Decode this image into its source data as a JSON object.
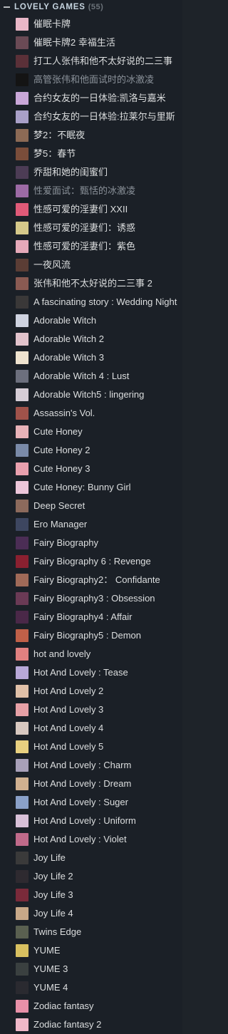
{
  "collection": {
    "name": "LOVELY GAMES",
    "count": "(55)"
  },
  "games": [
    {
      "title": "催眠卡牌",
      "installed": true,
      "icon_color": "#e9b7c7"
    },
    {
      "title": "催眠卡牌2 幸福生活",
      "installed": true,
      "icon_color": "#6a4a55"
    },
    {
      "title": "打工人张伟和他不太好说的二三事",
      "installed": true,
      "icon_color": "#5a3038"
    },
    {
      "title": "高管张伟和他面试时的冰激凌",
      "installed": false,
      "icon_color": "#141414"
    },
    {
      "title": "合约女友的一日体验:凯洛与嘉米",
      "installed": true,
      "icon_color": "#c9a7d8"
    },
    {
      "title": "合约女友的一日体验:拉莱尔与里斯",
      "installed": true,
      "icon_color": "#a9a0c8"
    },
    {
      "title": "梦2：不眠夜",
      "installed": true,
      "icon_color": "#8c6a55"
    },
    {
      "title": "梦5：春节",
      "installed": true,
      "icon_color": "#7a4d3a"
    },
    {
      "title": "乔甜和她的闺蜜们",
      "installed": true,
      "icon_color": "#4c3c55"
    },
    {
      "title": "性爱面试：甄恬的冰激凌",
      "installed": false,
      "icon_color": "#9c6aa5"
    },
    {
      "title": "性感可爱的淫妻们 XXII",
      "installed": true,
      "icon_color": "#e05a78"
    },
    {
      "title": "性感可爱的淫妻们：诱惑",
      "installed": true,
      "icon_color": "#d6c98a"
    },
    {
      "title": "性感可爱的淫妻们：紫色",
      "installed": true,
      "icon_color": "#e6a9b9"
    },
    {
      "title": "一夜风流",
      "installed": true,
      "icon_color": "#5b3d35"
    },
    {
      "title": "张伟和他不太好说的二三事 2",
      "installed": true,
      "icon_color": "#8a5a52"
    },
    {
      "title": "A fascinating story : Wedding Night",
      "installed": true,
      "icon_color": "#3a3838"
    },
    {
      "title": "Adorable Witch",
      "installed": true,
      "icon_color": "#cfd3e0"
    },
    {
      "title": "Adorable Witch 2",
      "installed": true,
      "icon_color": "#e2c3cc"
    },
    {
      "title": "Adorable Witch 3",
      "installed": true,
      "icon_color": "#efe3cf"
    },
    {
      "title": "Adorable Witch 4 :  Lust",
      "installed": true,
      "icon_color": "#6c6f7d"
    },
    {
      "title": "Adorable Witch5 : lingering",
      "installed": true,
      "icon_color": "#d6cdd6"
    },
    {
      "title": "Assassin's Vol.",
      "installed": true,
      "icon_color": "#a0524a"
    },
    {
      "title": "Cute Honey",
      "installed": true,
      "icon_color": "#e8b2b8"
    },
    {
      "title": "Cute Honey 2",
      "installed": true,
      "icon_color": "#7a8aa8"
    },
    {
      "title": "Cute Honey 3",
      "installed": true,
      "icon_color": "#e9a0ae"
    },
    {
      "title": "Cute Honey: Bunny Girl",
      "installed": true,
      "icon_color": "#ecc6da"
    },
    {
      "title": "Deep Secret",
      "installed": true,
      "icon_color": "#8c6a5c"
    },
    {
      "title": "Ero Manager",
      "installed": true,
      "icon_color": "#3d4660"
    },
    {
      "title": "Fairy Biography",
      "installed": true,
      "icon_color": "#4b2d55"
    },
    {
      "title": "Fairy Biography 6 : Revenge",
      "installed": true,
      "icon_color": "#8a2030"
    },
    {
      "title": "Fairy Biography2：  Confidante",
      "installed": true,
      "icon_color": "#a06a58"
    },
    {
      "title": "Fairy Biography3 : Obsession",
      "installed": true,
      "icon_color": "#6a3a55"
    },
    {
      "title": "Fairy Biography4 : Affair",
      "installed": true,
      "icon_color": "#4a2848"
    },
    {
      "title": "Fairy Biography5 : Demon",
      "installed": true,
      "icon_color": "#c06048"
    },
    {
      "title": "hot and lovely",
      "installed": true,
      "icon_color": "#e08080"
    },
    {
      "title": "Hot And Lovely : Tease",
      "installed": true,
      "icon_color": "#b8a8d8"
    },
    {
      "title": "Hot And Lovely 2",
      "installed": true,
      "icon_color": "#e0c0a8"
    },
    {
      "title": "Hot And Lovely 3",
      "installed": true,
      "icon_color": "#e6a0a6"
    },
    {
      "title": "Hot And Lovely 4",
      "installed": true,
      "icon_color": "#d8c8c0"
    },
    {
      "title": "Hot And Lovely 5",
      "installed": true,
      "icon_color": "#e8d080"
    },
    {
      "title": "Hot And Lovely :  Charm",
      "installed": true,
      "icon_color": "#a8a0b8"
    },
    {
      "title": "Hot And Lovely :  Dream",
      "installed": true,
      "icon_color": "#d0b090"
    },
    {
      "title": "Hot And Lovely :  Suger",
      "installed": true,
      "icon_color": "#8aa0c8"
    },
    {
      "title": "Hot And Lovely :  Uniform",
      "installed": true,
      "icon_color": "#d8c0d8"
    },
    {
      "title": "Hot And Lovely :  Violet",
      "installed": true,
      "icon_color": "#c06a8a"
    },
    {
      "title": "Joy Life",
      "installed": true,
      "icon_color": "#3a3a3a"
    },
    {
      "title": "Joy Life 2",
      "installed": true,
      "icon_color": "#2e2a30"
    },
    {
      "title": "Joy Life 3",
      "installed": true,
      "icon_color": "#7a2a3a"
    },
    {
      "title": "Joy Life 4",
      "installed": true,
      "icon_color": "#c8a888"
    },
    {
      "title": "Twins Edge",
      "installed": true,
      "icon_color": "#5a6050"
    },
    {
      "title": "YUME",
      "installed": true,
      "icon_color": "#d8c060"
    },
    {
      "title": "YUME 3",
      "installed": true,
      "icon_color": "#3a4040"
    },
    {
      "title": "YUME 4",
      "installed": true,
      "icon_color": "#2a2a30"
    },
    {
      "title": "Zodiac fantasy",
      "installed": true,
      "icon_color": "#e890a8"
    },
    {
      "title": "Zodiac fantasy 2",
      "installed": true,
      "icon_color": "#f0b8c8"
    }
  ]
}
